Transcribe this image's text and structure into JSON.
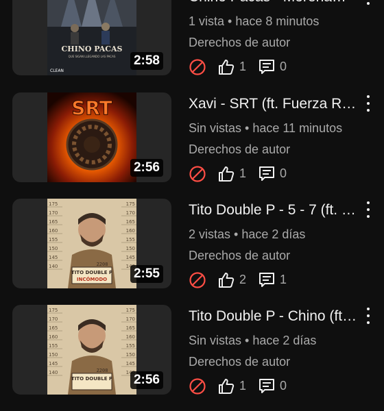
{
  "videos": [
    {
      "title": "Chino Pacas - Morena…",
      "views": "1 vista",
      "age": "hace 8 minutos",
      "duration": "2:58",
      "rights": "Derechos de autor",
      "likes": "1",
      "comments": "0",
      "art_text": "CHINO PACAS",
      "art_sub": "QUE SIGAN LLEGANDO LAS PACAS",
      "art_tag": "CLEAN"
    },
    {
      "title": "Xavi - SRT (ft. Fuerza Regida)",
      "views": "Sin vistas",
      "age": "hace 11 minutos",
      "duration": "2:56",
      "rights": "Derechos de autor",
      "likes": "1",
      "comments": "0",
      "art_text": "SRT"
    },
    {
      "title": "Tito Double P - 5 - 7 (ft. …",
      "views": "2 vistas",
      "age": "hace 2 días",
      "duration": "2:55",
      "rights": "Derechos de autor",
      "likes": "2",
      "comments": "1",
      "art_text": "TITO DOUBLE P",
      "art_sub": "INCÓMODO",
      "art_tag": "2208"
    },
    {
      "title": "Tito Double P - Chino (ft. …",
      "views": "Sin vistas",
      "age": "hace 2 días",
      "duration": "2:56",
      "rights": "Derechos de autor",
      "likes": "1",
      "comments": "0",
      "art_text": "TITO DOUBLE P",
      "art_tag": "2208"
    }
  ],
  "separator": " • ",
  "height_marks": [
    "175",
    "170",
    "165",
    "160",
    "155",
    "150",
    "145",
    "140"
  ],
  "colors": {
    "background": "#0f0f0f",
    "primary_text": "#f1f1f1",
    "secondary_text": "#aaaaaa",
    "restriction_red": "#ff4e45"
  },
  "icons": {
    "restriction": "no-entry-circle-icon",
    "like": "thumbs-up-icon",
    "comments": "comment-icon",
    "menu": "more-vert-icon"
  }
}
